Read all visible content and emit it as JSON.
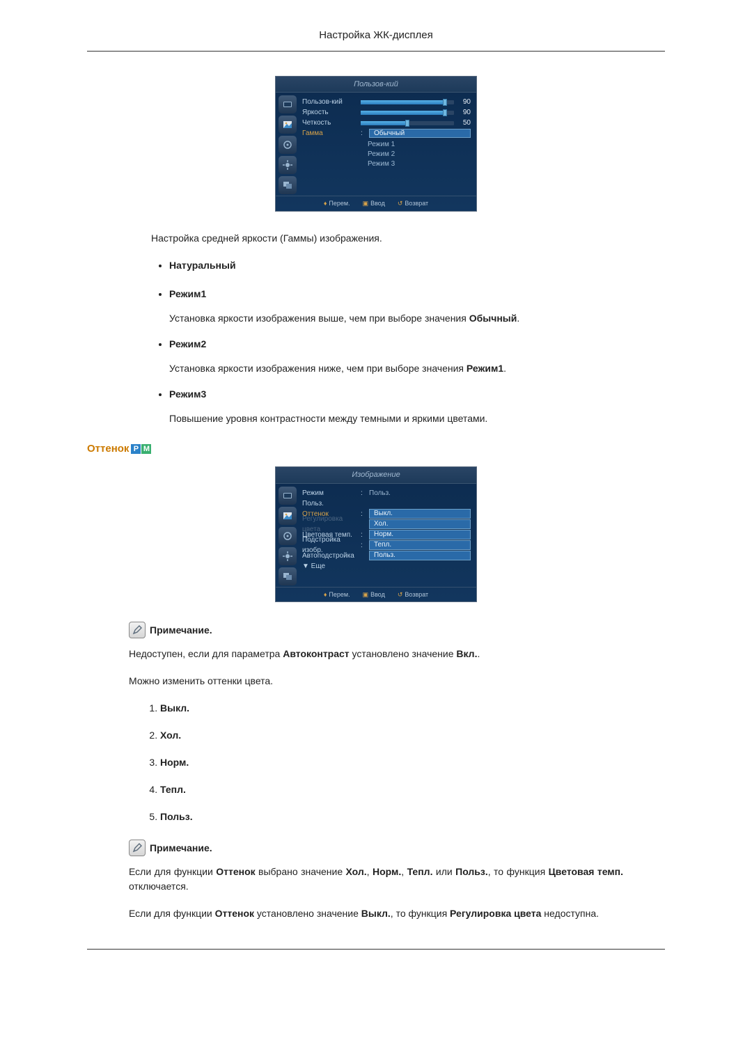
{
  "page_title": "Настройка ЖК-дисплея",
  "osd1": {
    "header": "Пользов-кий",
    "rows": [
      {
        "label": "Пользов-кий",
        "value": "90",
        "fill": 90
      },
      {
        "label": "Яркость",
        "value": "90",
        "fill": 90
      },
      {
        "label": "Четкость",
        "value": "50",
        "fill": 50
      }
    ],
    "gamma_label": "Гамма",
    "gamma_selected": "Обычный",
    "gamma_options": [
      "Режим 1",
      "Режим 2",
      "Режим 3"
    ],
    "footer": {
      "move": "Перем.",
      "enter": "Ввод",
      "return": "Возврат"
    }
  },
  "gamma_intro": "Настройка средней яркости (Гаммы) изображения.",
  "bullets": {
    "b1": "Натуральный",
    "b2": "Режим1",
    "b2_desc_pre": "Установка яркости изображения выше, чем при выборе значения ",
    "b2_desc_bold": "Обычный",
    "b3": "Режим2",
    "b3_desc_pre": "Установка яркости изображения ниже, чем при выборе значения ",
    "b3_desc_bold": "Режим1",
    "b4": "Режим3",
    "b4_desc": "Повышение уровня контрастности между темными и яркими цветами."
  },
  "section_tint": "Оттенок",
  "osd2": {
    "header": "Изображение",
    "rows": [
      {
        "label": "Режим",
        "value": "Польз."
      },
      {
        "label": "Польз.",
        "value": ""
      },
      {
        "label": "Оттенок",
        "cls": "orange"
      },
      {
        "label": "Регулировка цвета",
        "cls": "dim"
      },
      {
        "label": "Цветовая темп."
      },
      {
        "label": "Подстройка изобр."
      },
      {
        "label": "Автоподстройка"
      },
      {
        "label": "▼ Еще"
      }
    ],
    "options": [
      "Выкл.",
      "Хол.",
      "Норм.",
      "Тепл.",
      "Польз."
    ],
    "footer": {
      "move": "Перем.",
      "enter": "Ввод",
      "return": "Возврат"
    }
  },
  "note_label": "Примечание.",
  "note1_pre": "Недоступен, если для параметра ",
  "note1_b1": "Автоконтраст",
  "note1_mid": " установлено значение ",
  "note1_b2": "Вкл.",
  "desc_tint": "Можно изменить оттенки цвета.",
  "ol": [
    "Выкл.",
    "Хол.",
    "Норм.",
    "Тепл.",
    "Польз."
  ],
  "note2_p1_1": "Если для функции ",
  "note2_p1_b1": "Оттенок",
  "note2_p1_2": " выбрано значение ",
  "note2_p1_b2": "Хол.",
  "note2_p1_3": ", ",
  "note2_p1_b3": "Норм.",
  "note2_p1_4": ", ",
  "note2_p1_b4": "Тепл.",
  "note2_p1_5": " или ",
  "note2_p1_b5": "Польз.",
  "note2_p1_6": ", то функция ",
  "note2_p1_b6": "Цветовая темп.",
  "note2_p1_7": " отключается.",
  "note2_p2_1": "Если для функции ",
  "note2_p2_b1": "Оттенок",
  "note2_p2_2": " установлено значение ",
  "note2_p2_b2": "Выкл.",
  "note2_p2_3": ", то функция ",
  "note2_p2_b3": "Регулировка цвета",
  "note2_p2_4": " недоступна."
}
